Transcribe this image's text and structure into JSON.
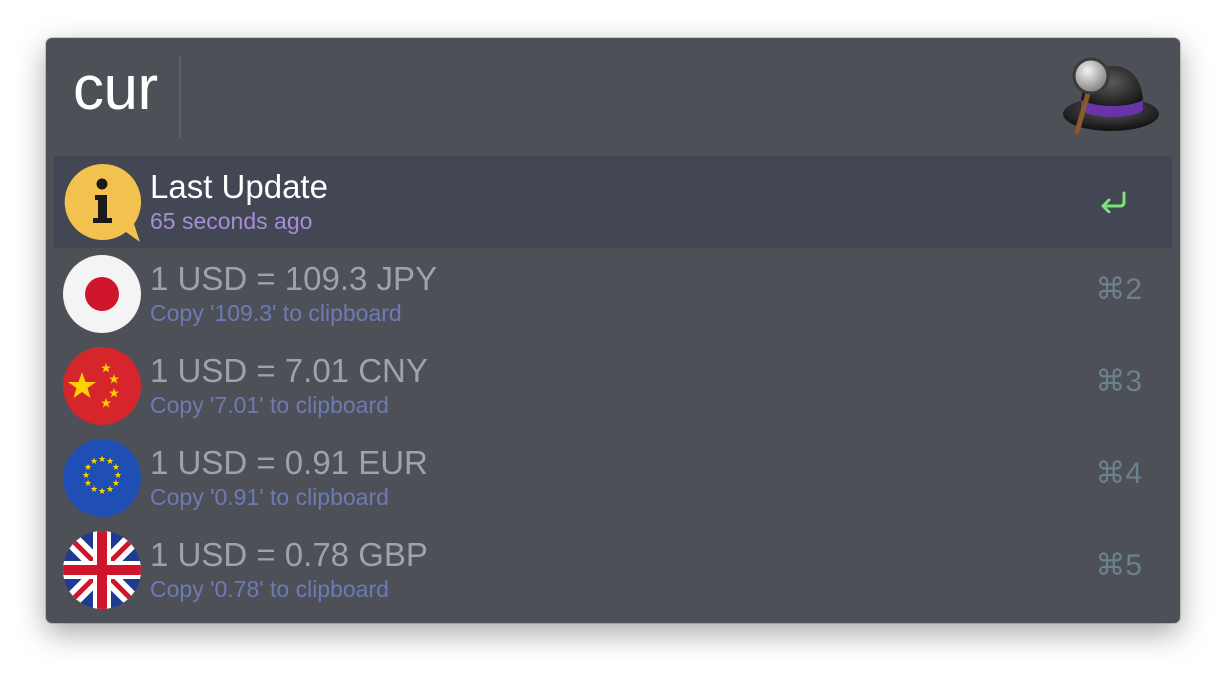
{
  "search": {
    "query": "cur"
  },
  "app": {
    "logo_icon": "alfred-hat-icon"
  },
  "results": [
    {
      "title": "Last Update",
      "subtitle": "65 seconds ago",
      "icon": "info-icon",
      "action": "return-icon",
      "selected": true
    },
    {
      "title": "1 USD = 109.3 JPY",
      "subtitle": "Copy '109.3' to clipboard",
      "icon": "japan-flag-icon",
      "shortcut": "⌘2"
    },
    {
      "title": "1 USD = 7.01 CNY",
      "subtitle": "Copy '7.01' to clipboard",
      "icon": "china-flag-icon",
      "shortcut": "⌘3"
    },
    {
      "title": "1 USD = 0.91 EUR",
      "subtitle": "Copy '0.91' to clipboard",
      "icon": "eu-flag-icon",
      "shortcut": "⌘4"
    },
    {
      "title": "1 USD = 0.78 GBP",
      "subtitle": "Copy '0.78' to clipboard",
      "icon": "uk-flag-icon",
      "shortcut": "⌘5"
    }
  ],
  "colors": {
    "window_bg": "#4e5058",
    "selected_bg": "#434653",
    "selected_subtitle": "#a58fd6",
    "subtitle": "#6c7bb5",
    "shortcut": "#6b828c",
    "return_arrow": "#7fe07f"
  }
}
